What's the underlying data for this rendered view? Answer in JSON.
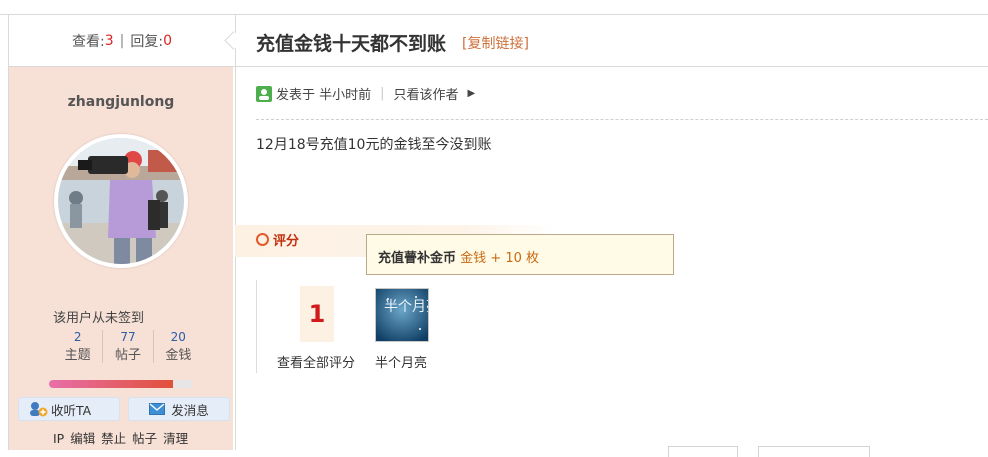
{
  "thread": {
    "views_label": "查看:",
    "views": "3",
    "separator": "|",
    "replies_label": "回复:",
    "replies": "0",
    "title": "充值金钱十天都不到账",
    "copy_link": "[复制链接]"
  },
  "author": {
    "username": "zhangjunlong",
    "signin_status": "该用户从未签到",
    "stats": [
      {
        "value": "2",
        "label": "主题"
      },
      {
        "value": "77",
        "label": "帖子"
      },
      {
        "value": "20",
        "label": "金钱"
      }
    ],
    "level_progress": 0.86,
    "follow_label": "收听TA",
    "message_label": "发消息",
    "admin_links": "IP 编辑 禁止 帖子 清理"
  },
  "post": {
    "posted_at": "发表于 半小时前",
    "only_author": "只看该作者",
    "content": "12月18号充值10元的金钱至今没到账"
  },
  "rating": {
    "header": "评分",
    "tooltip_prefix": "充值瞢补金币",
    "tooltip_reward": "金钱 + 10 枚",
    "count": "1",
    "view_all": "查看全部评分",
    "rater_name": "半个月亮",
    "rater_avatar_text": "半个月亮"
  },
  "colors": {
    "accent": "#d22222",
    "profile_bg": "#f7e0d6",
    "link": "#d0703a"
  }
}
